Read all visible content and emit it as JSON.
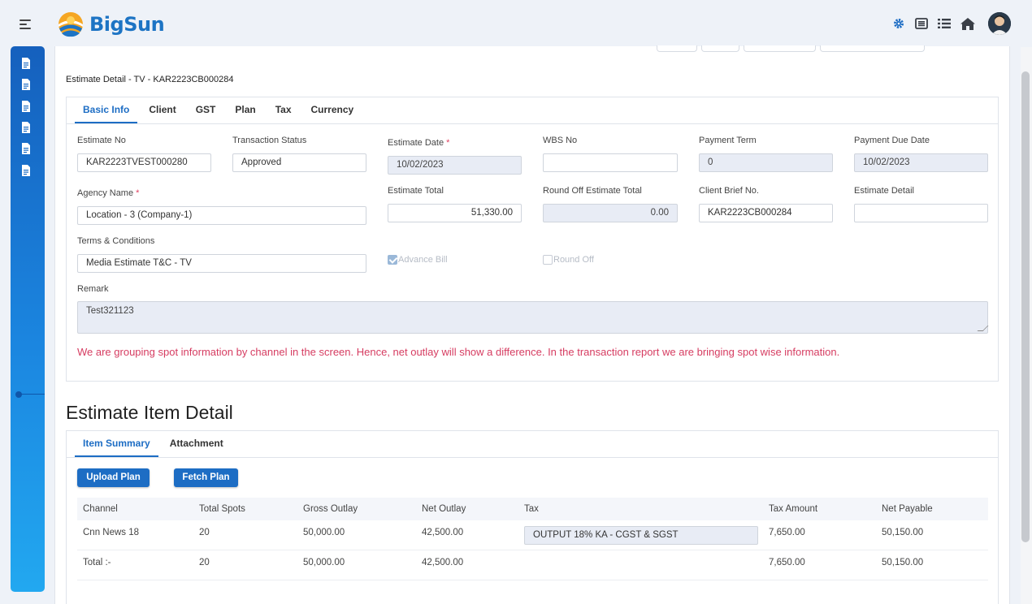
{
  "brand": {
    "name": "BigSun"
  },
  "header": {
    "icons": [
      "gear-icon",
      "list-alt-icon",
      "list-icon",
      "home-icon",
      "avatar"
    ]
  },
  "page": {
    "title": "Estimate Detail -  TV - KAR2223CB000284"
  },
  "tabs": [
    {
      "label": "Basic Info",
      "active": true
    },
    {
      "label": "Client"
    },
    {
      "label": "GST"
    },
    {
      "label": "Plan"
    },
    {
      "label": "Tax"
    },
    {
      "label": "Currency"
    }
  ],
  "form": {
    "estimate_no": {
      "label": "Estimate No",
      "value": "KAR2223TVEST000280"
    },
    "transaction_status": {
      "label": "Transaction Status",
      "value": "Approved"
    },
    "estimate_date": {
      "label": "Estimate Date",
      "required": "*",
      "value": "10/02/2023"
    },
    "wbs_no": {
      "label": "WBS No",
      "value": ""
    },
    "payment_term": {
      "label": "Payment Term",
      "value": "0"
    },
    "payment_due_date": {
      "label": "Payment Due Date",
      "value": "10/02/2023"
    },
    "agency_name": {
      "label": "Agency Name",
      "required": "*",
      "value": "Location - 3 (Company-1)"
    },
    "estimate_total": {
      "label": "Estimate Total",
      "value": "51,330.00"
    },
    "round_off_total": {
      "label": "Round Off Estimate Total",
      "value": "0.00"
    },
    "client_brief_no": {
      "label": "Client Brief No.",
      "value": "KAR2223CB000284"
    },
    "estimate_detail": {
      "label": "Estimate Detail",
      "value": ""
    },
    "terms": {
      "label": "Terms & Conditions",
      "value": "Media Estimate T&C - TV"
    },
    "advance_bill": {
      "label": "Advance Bill",
      "checked": true
    },
    "round_off": {
      "label": "Round Off",
      "checked": false
    },
    "remark": {
      "label": "Remark",
      "value": "Test321123"
    }
  },
  "warning": "We are grouping spot information by channel in the screen. Hence, net outlay will show a difference. In the transaction report we are bringing spot wise information.",
  "items": {
    "title": "Estimate Item Detail",
    "tabs": [
      {
        "label": "Item Summary",
        "active": true
      },
      {
        "label": "Attachment"
      }
    ],
    "upload_label": "Upload Plan",
    "fetch_label": "Fetch Plan",
    "columns": [
      "Channel",
      "Total Spots",
      "Gross Outlay",
      "Net Outlay",
      "Tax",
      "Tax Amount",
      "Net Payable"
    ],
    "rows": [
      {
        "channel": "Cnn News 18",
        "spots": "20",
        "gross": "50,000.00",
        "net": "42,500.00",
        "tax": "OUTPUT 18% KA - CGST & SGST",
        "tax_amount": "7,650.00",
        "payable": "50,150.00"
      }
    ],
    "total": {
      "label": "Total :-",
      "spots": "20",
      "gross": "50,000.00",
      "net": "42,500.00",
      "tax_amount": "7,650.00",
      "payable": "50,150.00"
    }
  },
  "colors": {
    "primary": "#1d6dc4",
    "warning": "#d63c61",
    "readonly": "#e8ecf5"
  }
}
